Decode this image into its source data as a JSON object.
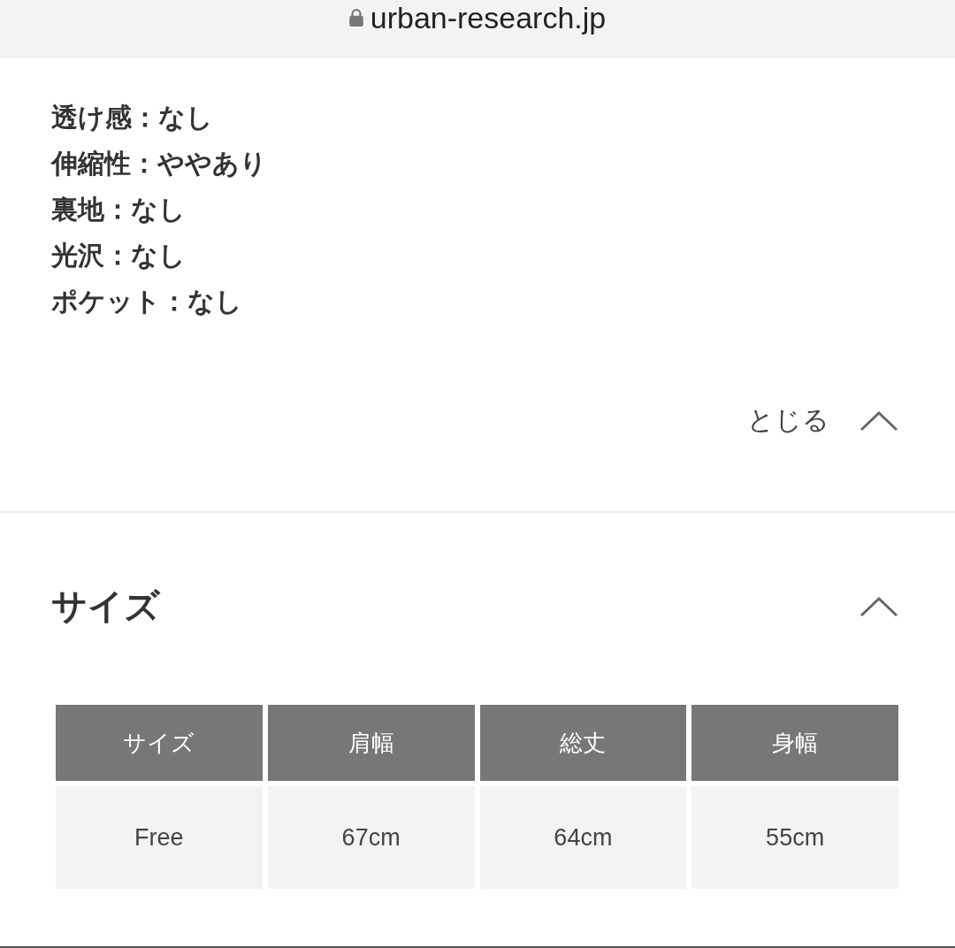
{
  "address_bar": {
    "url": "urban-research.jp"
  },
  "specs": [
    "透け感：なし",
    "伸縮性：ややあり",
    "裏地：なし",
    "光沢：なし",
    "ポケット：なし"
  ],
  "close_toggle": {
    "label": "とじる",
    "expanded": true
  },
  "size_section": {
    "title": "サイズ",
    "expanded": true,
    "table": {
      "columns": [
        "サイズ",
        "肩幅",
        "総丈",
        "身幅"
      ],
      "rows": [
        [
          "Free",
          "67cm",
          "64cm",
          "55cm"
        ]
      ]
    }
  }
}
